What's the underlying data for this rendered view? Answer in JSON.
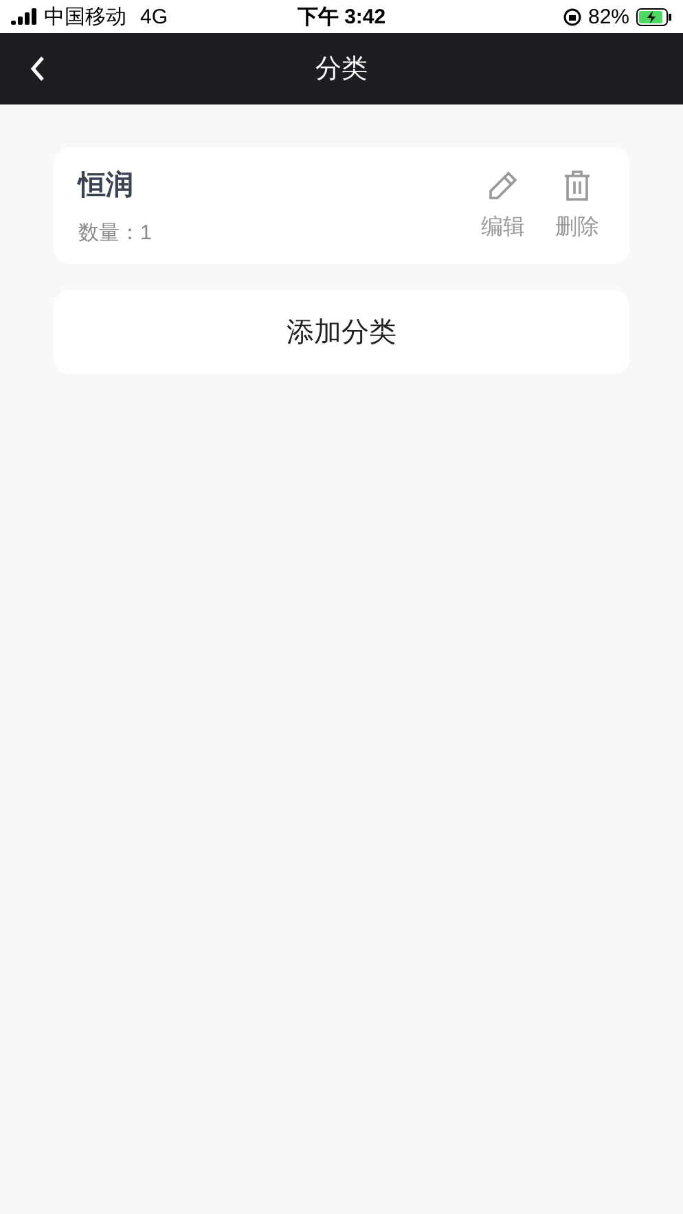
{
  "status_bar": {
    "carrier": "中国移动",
    "network": "4G",
    "time": "下午 3:42",
    "battery": "82%"
  },
  "nav": {
    "title": "分类"
  },
  "categories": [
    {
      "name": "恒润",
      "count": "数量：1",
      "actions": [
        {
          "kind": "edit",
          "label": "编辑"
        },
        {
          "kind": "delete",
          "label": "删除"
        }
      ]
    }
  ],
  "add_button": "添加分类"
}
